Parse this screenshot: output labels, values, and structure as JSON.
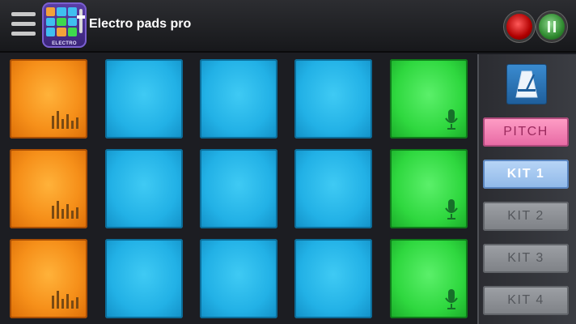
{
  "app": {
    "title": "Electro pads pro",
    "logo_label": "ELECTRO"
  },
  "icons": {
    "menu": "hamburger-menu-icon",
    "record": "record-icon",
    "play": "pause-icon",
    "metronome": "metronome-icon",
    "pad_bars": "equalizer-icon",
    "pad_mic": "microphone-icon"
  },
  "colors": {
    "orange_pad": "#f6901a",
    "blue_pad": "#22b1e6",
    "green_pad": "#2fd83f",
    "pitch": "#e768a3",
    "kit_active": "#8fb8e8",
    "kit_inactive": "#7d8085"
  },
  "pads": [
    [
      "orange",
      "blue",
      "blue",
      "blue",
      "green"
    ],
    [
      "orange",
      "blue",
      "blue",
      "blue",
      "green"
    ],
    [
      "orange",
      "blue",
      "blue",
      "blue",
      "green"
    ]
  ],
  "side": {
    "pitch_label": "PITCH",
    "kits": [
      {
        "label": "KIT 1",
        "active": true
      },
      {
        "label": "KIT 2",
        "active": false
      },
      {
        "label": "KIT 3",
        "active": false
      },
      {
        "label": "KIT 4",
        "active": false
      }
    ]
  }
}
